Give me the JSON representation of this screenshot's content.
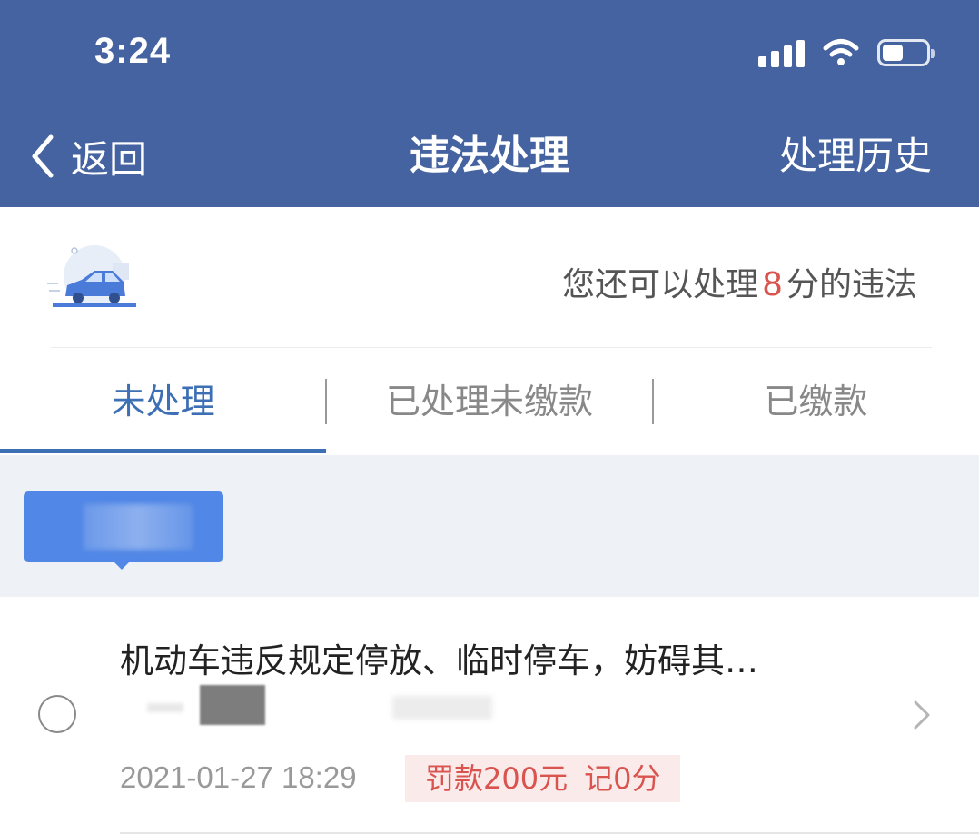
{
  "status_bar": {
    "time": "3:24",
    "icons": [
      "cellular-signal-icon",
      "wifi-icon",
      "battery-icon"
    ]
  },
  "nav": {
    "back_label": "返回",
    "title": "违法处理",
    "right_label": "处理历史",
    "background_color": "#4563a0"
  },
  "summary": {
    "text_prefix": "您还可以处理",
    "points": "8",
    "text_suffix": "分的违法",
    "highlight_color": "#d9534f"
  },
  "tabs": [
    {
      "label": "未处理",
      "active": true
    },
    {
      "label": "已处理未缴款",
      "active": false
    },
    {
      "label": "已缴款",
      "active": false
    }
  ],
  "active_color": "#3d6fb5",
  "violations": [
    {
      "title": "机动车违反规定停放、临时停车，妨碍其…",
      "datetime": "2021-01-27 18:29",
      "fine_label": "罚款200元",
      "points_label": "记0分"
    }
  ]
}
